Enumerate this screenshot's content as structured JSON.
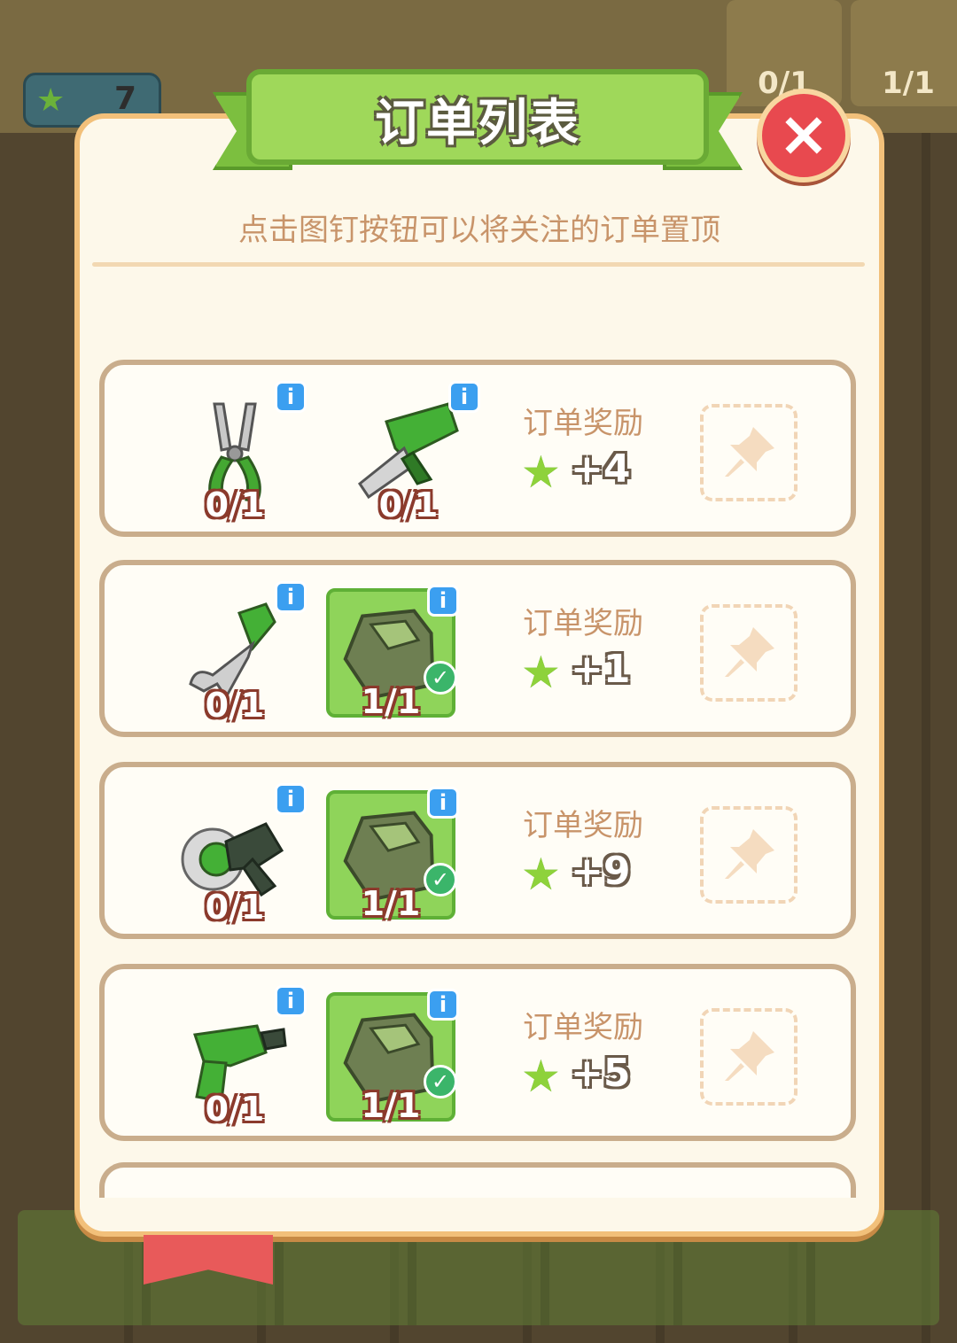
{
  "background": {
    "star_count": "7",
    "top_items": [
      {
        "count": "0/1"
      },
      {
        "count": "1/1"
      }
    ]
  },
  "dialog": {
    "title": "订单列表",
    "hint": "点击图钉按钮可以将关注的订单置顶",
    "close_icon": "close-icon"
  },
  "orders": [
    {
      "items": [
        {
          "icon": "pliers-icon",
          "count": "0/1",
          "done": false
        },
        {
          "icon": "saw-drill-icon",
          "count": "0/1",
          "done": false
        }
      ],
      "reward_label": "订单奖励",
      "reward": "+4"
    },
    {
      "items": [
        {
          "icon": "wrench-icon",
          "count": "0/1",
          "done": false
        },
        {
          "icon": "glove-icon",
          "count": "1/1",
          "done": true
        }
      ],
      "reward_label": "订单奖励",
      "reward": "+1"
    },
    {
      "items": [
        {
          "icon": "grinder-icon",
          "count": "0/1",
          "done": false
        },
        {
          "icon": "glove-icon",
          "count": "1/1",
          "done": true
        }
      ],
      "reward_label": "订单奖励",
      "reward": "+9"
    },
    {
      "items": [
        {
          "icon": "drill-icon",
          "count": "0/1",
          "done": false
        },
        {
          "icon": "glove-icon",
          "count": "1/1",
          "done": true
        }
      ],
      "reward_label": "订单奖励",
      "reward": "+5"
    }
  ],
  "colors": {
    "panel": "#fdf8ea",
    "ribbon": "#9fd85a",
    "close": "#e8494f",
    "done_slot": "#8fd45a",
    "star": "#8ed23b"
  }
}
